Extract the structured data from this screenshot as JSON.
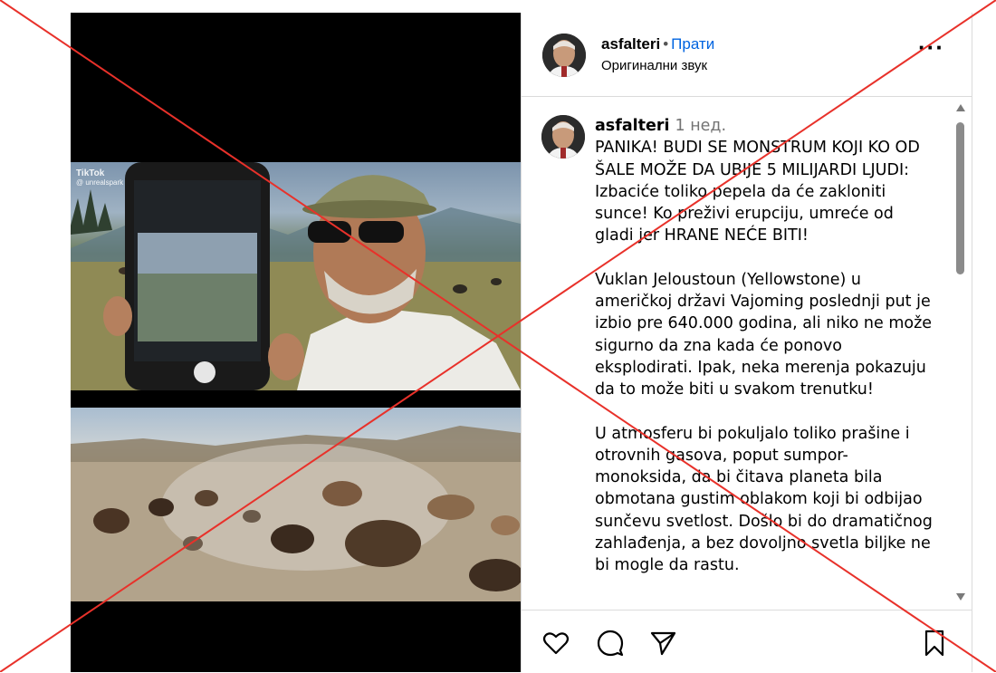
{
  "media": {
    "watermark_brand": "TikTok",
    "watermark_handle": "@ unrealspark"
  },
  "post": {
    "username": "asfalteri",
    "separator": "•",
    "follow_label": "Прати",
    "audio_label": "Оригинални звук",
    "more_label": "···"
  },
  "caption": {
    "username": "asfalteri",
    "time": "1 нед.",
    "paragraphs": [
      "PANIKA! BUDI SE MONSTRUM KOJI KO OD ŠALE MOŽE DA UBIJE 5 MILIJARDI LJUDI: Izbaciće toliko pepela da će zakloniti sunce! Ko preživi erupciju, umreće od gladi jer HRANE NEĆE BITI!",
      "Vuklan Jeloustoun (Yellowstone) u američkoj državi Vajoming poslednji put je izbio pre 640.000 godina, ali niko ne može sigurno da zna kada će ponovo eksplodirati. Ipak, neka merenja pokazuju da to može biti u svakom trenutku!",
      "U atmosferu bi pokuljalo toliko prašine i otrovnih gasova, poput sumpor-monoksida, da bi čitava planeta bila obmotana gustim oblakom koji bi odbijao sunčevu svetlost. Došlo bi do dramatičnog zahlađenja, a bez dovoljno svetla biljke ne bi mogle da rastu."
    ]
  },
  "colors": {
    "follow": "#0064e0",
    "overlay_x": "#e8312a"
  },
  "icons": [
    "heart-icon",
    "comment-icon",
    "share-icon",
    "bookmark-icon"
  ]
}
